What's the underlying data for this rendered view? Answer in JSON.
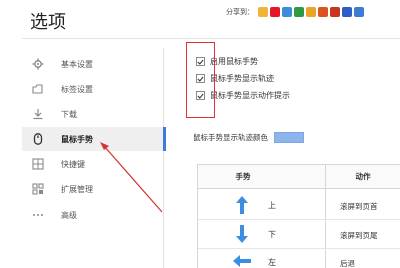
{
  "window": {
    "title": "选项"
  },
  "share": {
    "label": "分享到：",
    "icons": [
      {
        "name": "qq-space-icon",
        "color": "#f2b437"
      },
      {
        "name": "weibo-icon",
        "color": "#e6162d"
      },
      {
        "name": "tencent-weibo-icon",
        "color": "#3d8ddb"
      },
      {
        "name": "douban-icon",
        "color": "#2f9a44"
      },
      {
        "name": "star-icon",
        "color": "#e8a426"
      },
      {
        "name": "renren-icon",
        "color": "#d9541e"
      },
      {
        "name": "kaixin-icon",
        "color": "#c7361f"
      },
      {
        "name": "baidu-icon",
        "color": "#2e5dc7"
      },
      {
        "name": "tieba-icon",
        "color": "#3e7cd3"
      }
    ]
  },
  "sidebar": {
    "items": [
      {
        "label": "基本设置",
        "icon": "gear-icon",
        "active": false
      },
      {
        "label": "标签设置",
        "icon": "tab-icon",
        "active": false
      },
      {
        "label": "下载",
        "icon": "download-icon",
        "active": false
      },
      {
        "label": "鼠标手势",
        "icon": "mouse-icon",
        "active": true
      },
      {
        "label": "快捷键",
        "icon": "shortcut-icon",
        "active": false
      },
      {
        "label": "扩展管理",
        "icon": "extension-icon",
        "active": false
      },
      {
        "label": "高级",
        "icon": "more-icon",
        "active": false
      }
    ]
  },
  "gesture_options": [
    {
      "label": "启用鼠标手势",
      "checked": true
    },
    {
      "label": "鼠标手势显示轨迹",
      "checked": true
    },
    {
      "label": "鼠标手势显示动作提示",
      "checked": true
    }
  ],
  "track_color": {
    "label": "鼠标手势显示轨迹颜色",
    "value": "#8db5ec"
  },
  "gesture_table": {
    "headers": [
      "手势",
      "动作"
    ],
    "rows": [
      {
        "arrow": "up",
        "direction": "上",
        "action": "滚屏到页首"
      },
      {
        "arrow": "down",
        "direction": "下",
        "action": "滚屏到页尾"
      },
      {
        "arrow": "left",
        "direction": "左",
        "action": "后退"
      }
    ]
  },
  "colors": {
    "accent": "#3b7dd8",
    "annotation": "#d33333",
    "arrow": "#3b8ee0"
  }
}
